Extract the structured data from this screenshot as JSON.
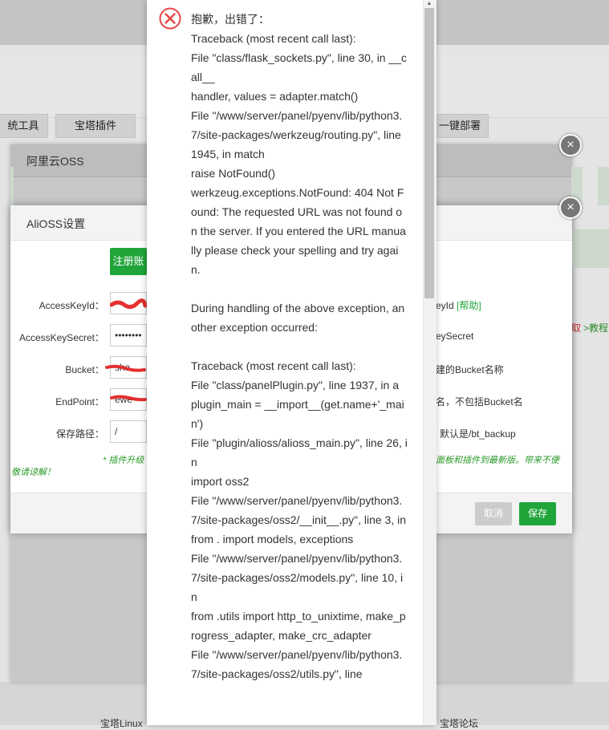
{
  "background": {
    "tabs": [
      "统工具",
      "宝塔插件",
      "一键部署"
    ],
    "side_right_link_1": "取",
    "side_right_link_2": ">教程",
    "bottom_left_text": "宝塔Linux",
    "bottom_right_text": "宝塔论坛"
  },
  "outer_dialog": {
    "title": "阿里云OSS",
    "close_label": "×"
  },
  "settings_dialog": {
    "title": "AliOSS设置",
    "close_label": "×",
    "register_button": "注册账",
    "fields": [
      {
        "label": "AccessKeyId：",
        "value": "",
        "help": "eyId",
        "help_link": "[帮助]"
      },
      {
        "label": "AccessKeySecret：",
        "value": "••••••••",
        "help": "eySecret"
      },
      {
        "label": "Bucket：",
        "value": "sha",
        "help": "建的Bucket名称"
      },
      {
        "label": "EndPoint：",
        "value": "ewe",
        "help": "名，不包括Bucket名"
      },
      {
        "label": "保存路径：",
        "value": "/",
        "help": "默认是/bt_backup"
      }
    ],
    "note_left": "* 插件升级",
    "note_right": "面板和插件到最新版。带来不便",
    "note_second_line": "敬请谅解！",
    "cancel_button": "取消",
    "save_button": "保存"
  },
  "error_popup": {
    "icon": "error-x-icon",
    "text": "抱歉，出错了：\nTraceback (most recent call last):\nFile \"class/flask_sockets.py\", line 30, in __call__\nhandler, values = adapter.match()\nFile \"/www/server/panel/pyenv/lib/python3.7/site-packages/werkzeug/routing.py\", line 1945, in match\nraise NotFound()\nwerkzeug.exceptions.NotFound: 404 Not Found: The requested URL was not found on the server. If you entered the URL manually please check your spelling and try again.\n\nDuring handling of the above exception, another exception occurred:\n\nTraceback (most recent call last):\nFile \"class/panelPlugin.py\", line 1937, in a\nplugin_main = __import__(get.name+'_main')\nFile \"plugin/alioss/alioss_main.py\", line 26, in\nimport oss2\nFile \"/www/server/panel/pyenv/lib/python3.7/site-packages/oss2/__init__.py\", line 3, in\nfrom . import models, exceptions\nFile \"/www/server/panel/pyenv/lib/python3.7/site-packages/oss2/models.py\", line 10, in\nfrom .utils import http_to_unixtime, make_progress_adapter, make_crc_adapter\nFile \"/www/server/panel/pyenv/lib/python3.7/site-packages/oss2/utils.py\", line"
  },
  "colors": {
    "accent_green": "#20a53a",
    "error_red": "#e64545"
  }
}
